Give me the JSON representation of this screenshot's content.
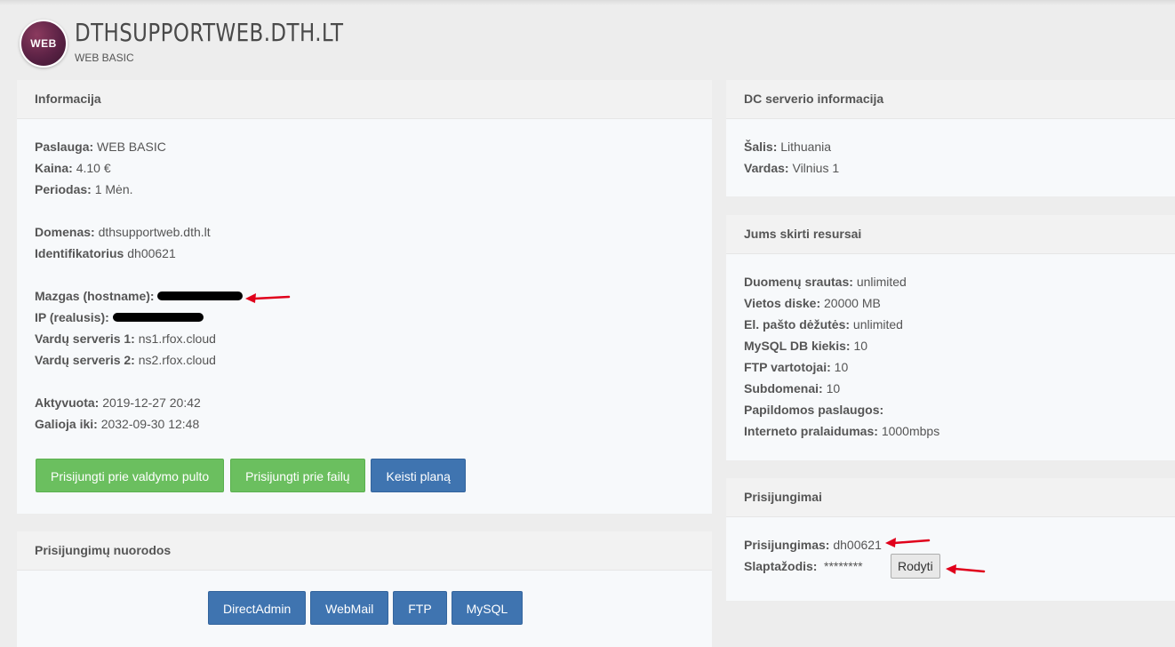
{
  "header": {
    "logo_text": "WEB",
    "title": "DTHSUPPORTWEB.DTH.LT",
    "subtitle": "WEB BASIC"
  },
  "info": {
    "heading": "Informacija",
    "service_label": "Paslauga:",
    "service_value": "WEB BASIC",
    "price_label": "Kaina:",
    "price_value": "4.10 €",
    "period_label": "Periodas:",
    "period_value": "1 Mėn.",
    "domain_label": "Domenas:",
    "domain_value": "dthsupportweb.dth.lt",
    "id_label": "Identifikatorius",
    "id_value": "dh00621",
    "hostname_label": "Mazgas (hostname):",
    "ip_label": "IP (realusis):",
    "ns1_label": "Vardų serveris 1:",
    "ns1_value": "ns1.rfox.cloud",
    "ns2_label": "Vardų serveris 2:",
    "ns2_value": "ns2.rfox.cloud",
    "activated_label": "Aktyvuota:",
    "activated_value": "2019-12-27 20:42",
    "valid_label": "Galioja iki:",
    "valid_value": "2032-09-30 12:48",
    "btn_panel": "Prisijungti prie valdymo pulto",
    "btn_files": "Prisijungti prie failų",
    "btn_plan": "Keisti planą"
  },
  "links": {
    "heading": "Prisijungimų nuorodos",
    "directadmin": "DirectAdmin",
    "webmail": "WebMail",
    "ftp": "FTP",
    "mysql": "MySQL"
  },
  "dc": {
    "heading": "DC serverio informacija",
    "country_label": "Šalis:",
    "country_value": "Lithuania",
    "name_label": "Vardas:",
    "name_value": "Vilnius 1"
  },
  "resources": {
    "heading": "Jums skirti resursai",
    "traffic_label": "Duomenų srautas:",
    "traffic_value": "unlimited",
    "disk_label": "Vietos diske:",
    "disk_value": "20000 MB",
    "mailbox_label": "El. pašto dėžutės:",
    "mailbox_value": "unlimited",
    "mysql_label": "MySQL DB kiekis:",
    "mysql_value": "10",
    "ftp_label": "FTP vartotojai:",
    "ftp_value": "10",
    "subdomains_label": "Subdomenai:",
    "subdomains_value": "10",
    "extra_label": "Papildomos paslaugos:",
    "bandwidth_label": "Interneto pralaidumas:",
    "bandwidth_value": "1000mbps"
  },
  "logins": {
    "heading": "Prisijungimai",
    "login_label": "Prisijungimas:",
    "login_value": "dh00621",
    "password_label": "Slaptažodis:",
    "password_value": "********",
    "show_button": "Rodyti"
  },
  "colors": {
    "green_button": "#6bbf5f",
    "blue_button": "#3f74b0",
    "annotation_arrow": "#e0001b",
    "page_background": "#ededed"
  }
}
